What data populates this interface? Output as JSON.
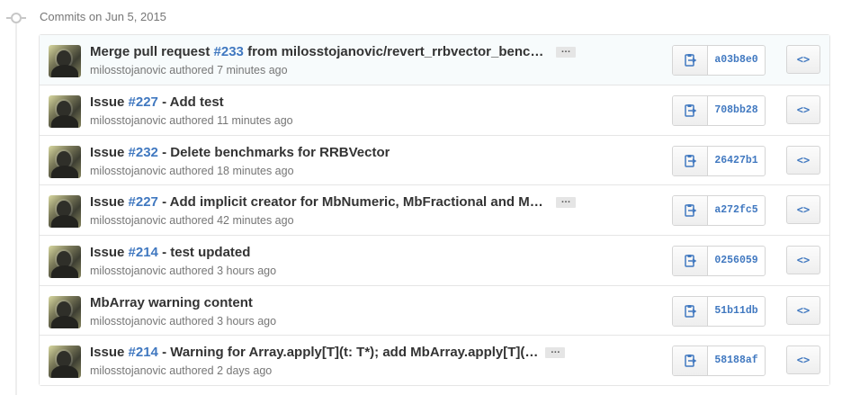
{
  "group": {
    "title": "Commits on Jun 5, 2015"
  },
  "commits": [
    {
      "prefix": "Merge pull request ",
      "issue": "#233",
      "suffix": " from milosstojanovic/revert_rrbvector_benchmarks",
      "has_more": true,
      "author": "milosstojanovic",
      "verb": " authored ",
      "time": "7 minutes ago",
      "sha": "a03b8e0"
    },
    {
      "prefix": "Issue ",
      "issue": "#227",
      "suffix": " - Add test",
      "has_more": false,
      "author": "milosstojanovic",
      "verb": " authored ",
      "time": "11 minutes ago",
      "sha": "708bb28"
    },
    {
      "prefix": "Issue ",
      "issue": "#232",
      "suffix": " - Delete benchmarks for RRBVector",
      "has_more": false,
      "author": "milosstojanovic",
      "verb": " authored ",
      "time": "18 minutes ago",
      "sha": "26427b1"
    },
    {
      "prefix": "Issue ",
      "issue": "#227",
      "suffix": " - Add implicit creator for MbNumeric, MbFractional and Mbl…",
      "has_more": true,
      "author": "milosstojanovic",
      "verb": " authored ",
      "time": "42 minutes ago",
      "sha": "a272fc5"
    },
    {
      "prefix": "Issue ",
      "issue": "#214",
      "suffix": " - test updated",
      "has_more": false,
      "author": "milosstojanovic",
      "verb": " authored ",
      "time": "3 hours ago",
      "sha": "0256059"
    },
    {
      "prefix": "MbArray warning content",
      "issue": "",
      "suffix": "",
      "has_more": false,
      "author": "milosstojanovic",
      "verb": " authored ",
      "time": "3 hours ago",
      "sha": "51b11db"
    },
    {
      "prefix": "Issue ",
      "issue": "#214",
      "suffix": " - Warning for Array.apply[T](t: T*); add MbArray.apply[T](…",
      "has_more": true,
      "author": "milosstojanovic",
      "verb": " authored ",
      "time": "2 days ago",
      "sha": "58188af"
    }
  ],
  "icons": {
    "copy": "clipboard-icon",
    "browse": "code-icon",
    "more": "ellipsis-icon",
    "timeline": "commit-icon"
  },
  "labels": {
    "ellipsis": "…",
    "browse": "<>"
  },
  "colors": {
    "link": "#4078c0",
    "muted": "#767676",
    "highlight_row": "#f7fbfc"
  }
}
